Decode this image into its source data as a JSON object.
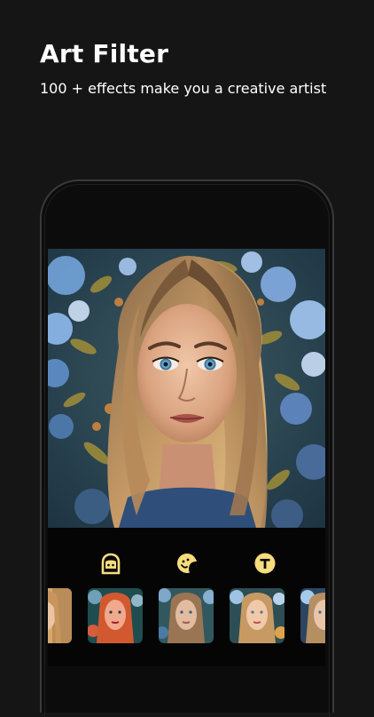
{
  "header": {
    "title": "Art Filter",
    "subtitle": "100 + effects make you a creative artist"
  },
  "colors": {
    "background": "#151515",
    "text": "#ffffff",
    "accent": "#f6dc7e",
    "phone_frame": "#3a3a3a"
  },
  "toolbar": {
    "tools": [
      {
        "name": "face-cartoon-icon",
        "active": true
      },
      {
        "name": "sticker-icon",
        "active": true
      },
      {
        "name": "text-icon",
        "active": true,
        "glyph": "T"
      }
    ]
  },
  "filters": {
    "thumbnails": [
      {
        "name": "filter-thumb-1",
        "style": "warm"
      },
      {
        "name": "filter-thumb-2",
        "style": "pop-red"
      },
      {
        "name": "filter-thumb-3",
        "style": "natural"
      },
      {
        "name": "filter-thumb-4",
        "style": "painted"
      },
      {
        "name": "filter-thumb-5",
        "style": "cool"
      }
    ]
  }
}
